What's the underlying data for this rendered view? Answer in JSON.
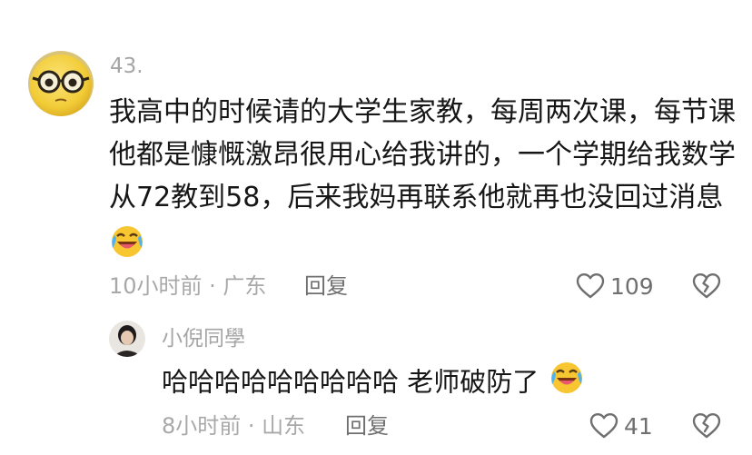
{
  "comment": {
    "username": "43.",
    "text_lines": [
      "我高中的时候请的大学生家教，每周两次课，每节课",
      "他都是慷慨激昂很用心给我讲的，一个学期给我数学",
      "从72教到58，后来我妈再联系他就再也没回过消息"
    ],
    "emoji": "laughing-crying-emoji",
    "time_location": "10小时前 · 广东",
    "reply_label": "回复",
    "like_count": "109"
  },
  "reply": {
    "username": "小倪同學",
    "text": "哈哈哈哈哈哈哈哈哈 老师破防了",
    "emoji": "laughing-crying-emoji",
    "time_location": "8小时前 · 山东",
    "reply_label": "回复",
    "like_count": "41"
  },
  "colors": {
    "text_primary": "#161616",
    "text_secondary": "#a5a5a5",
    "text_action": "#6f6f6f",
    "icon_stroke": "#6f6f6f",
    "avatar_yellow": "#f4cf3a"
  }
}
